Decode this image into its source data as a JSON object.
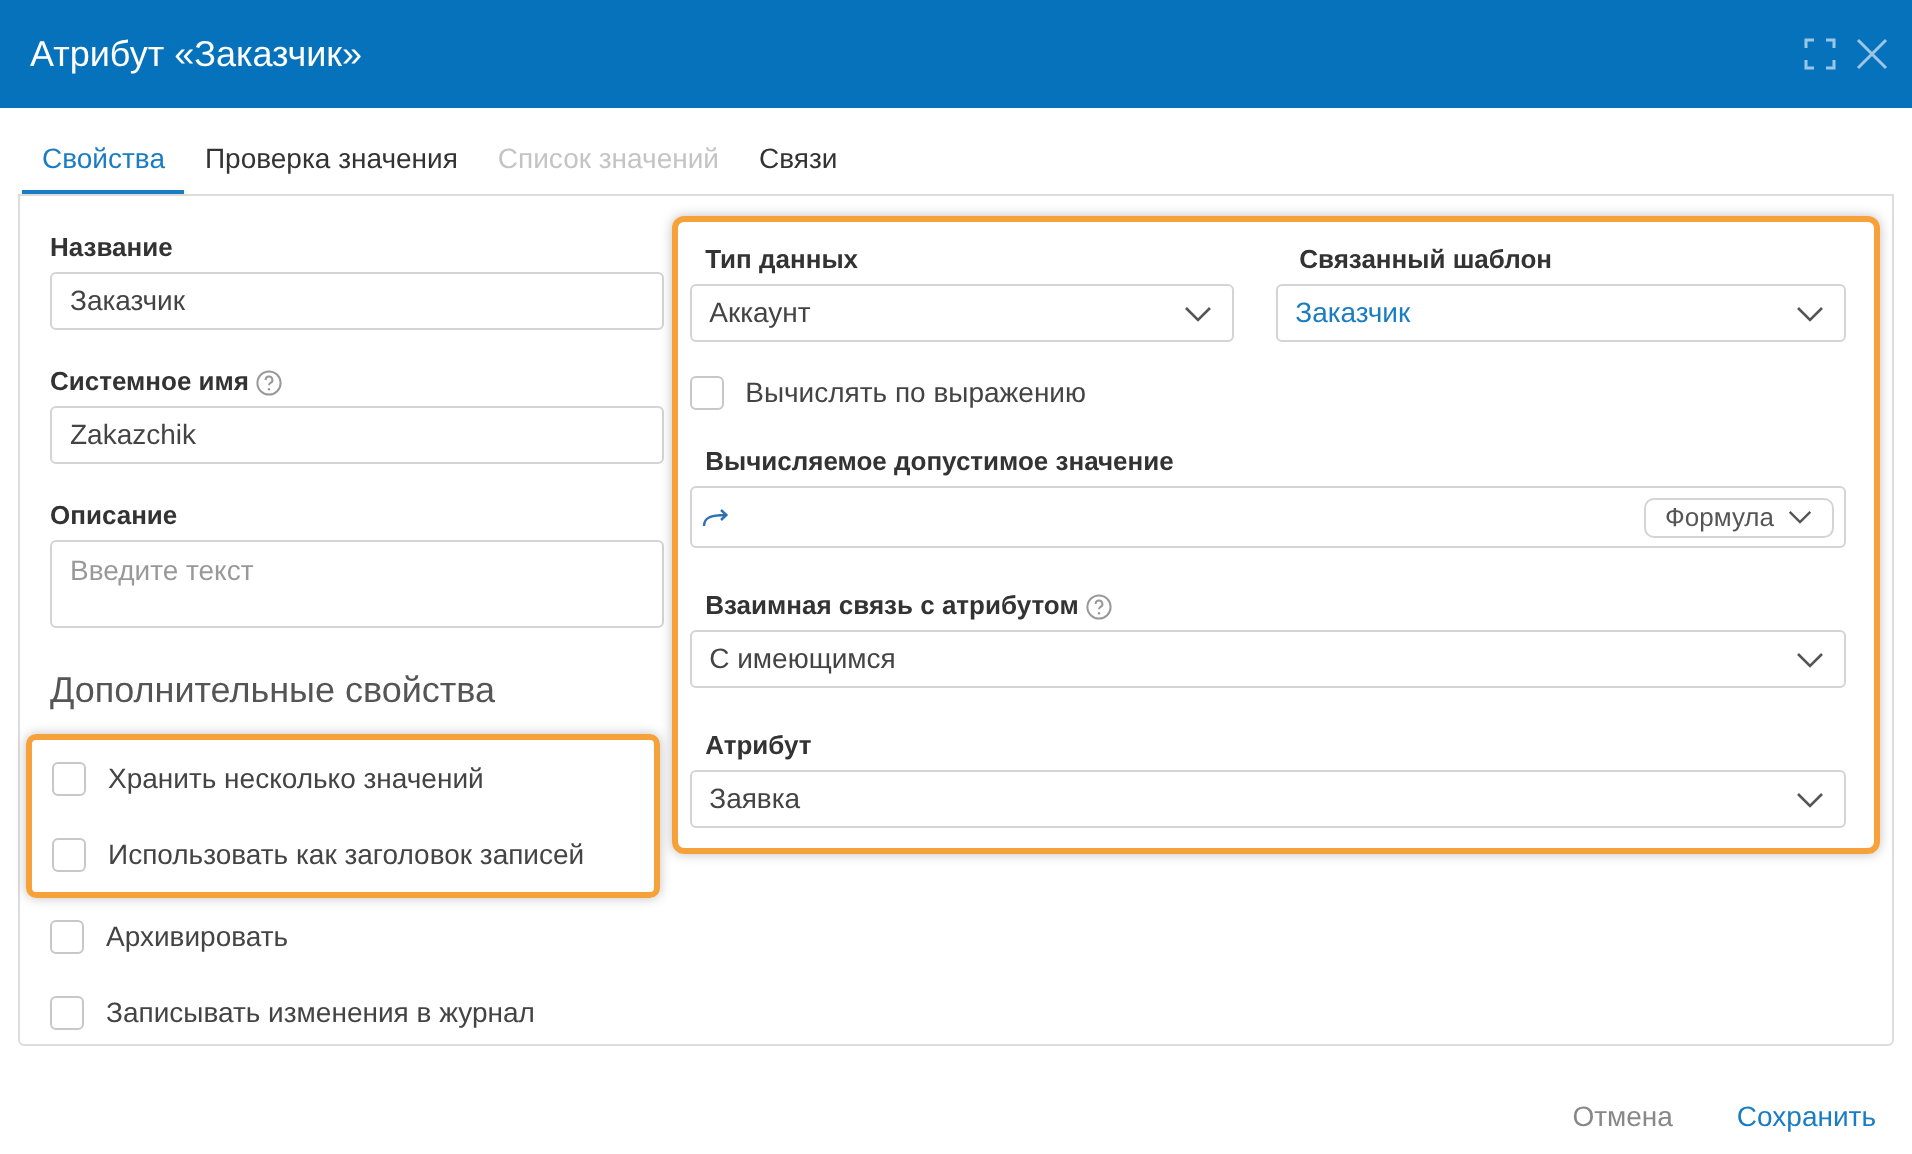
{
  "window": {
    "title": "Атрибут «Заказчик»"
  },
  "tabs": [
    {
      "label": "Свойства",
      "selected": true,
      "disabled": false
    },
    {
      "label": "Проверка значения",
      "selected": false,
      "disabled": false
    },
    {
      "label": "Список значений",
      "selected": false,
      "disabled": true
    },
    {
      "label": "Связи",
      "selected": false,
      "disabled": false
    }
  ],
  "fields": [
    {
      "kind": "input",
      "label": "Название",
      "help": false,
      "value": "Заказчик"
    },
    {
      "kind": "input",
      "label": "Системное имя",
      "help": true,
      "value": "Zakazchik"
    },
    {
      "kind": "textarea",
      "label": "Описание",
      "help": false,
      "placeholder": "Введите текст"
    }
  ],
  "section_title": "Дополнительные свойства",
  "options": [
    {
      "label": "Хранить несколько значений",
      "checked": false,
      "highlighted": true
    },
    {
      "label": "Использовать как заголовок записей",
      "checked": false,
      "highlighted": true
    },
    {
      "label": "Архивировать",
      "checked": false,
      "highlighted": false
    },
    {
      "label": "Записывать изменения в журнал",
      "checked": false,
      "highlighted": false
    }
  ],
  "right_panel": {
    "highlighted": true,
    "data_type": {
      "label": "Тип данных",
      "value": "Аккаунт"
    },
    "linked_template": {
      "label": "Связанный шаблон",
      "value": "Заказчик"
    },
    "compute_by_expression": {
      "label": "Вычислять по выражению",
      "checked": false
    },
    "computed_value": {
      "label": "Вычисляемое допустимое значение",
      "mode": "Формула"
    },
    "mutual_link": {
      "label": "Взаимная связь с атрибутом",
      "help": true,
      "value": "С имеющимся"
    },
    "attribute": {
      "label": "Атрибут",
      "value": "Заявка"
    }
  },
  "buttons": [
    {
      "label": "Отмена",
      "kind": "secondary"
    },
    {
      "label": "Сохранить",
      "kind": "primary"
    }
  ]
}
